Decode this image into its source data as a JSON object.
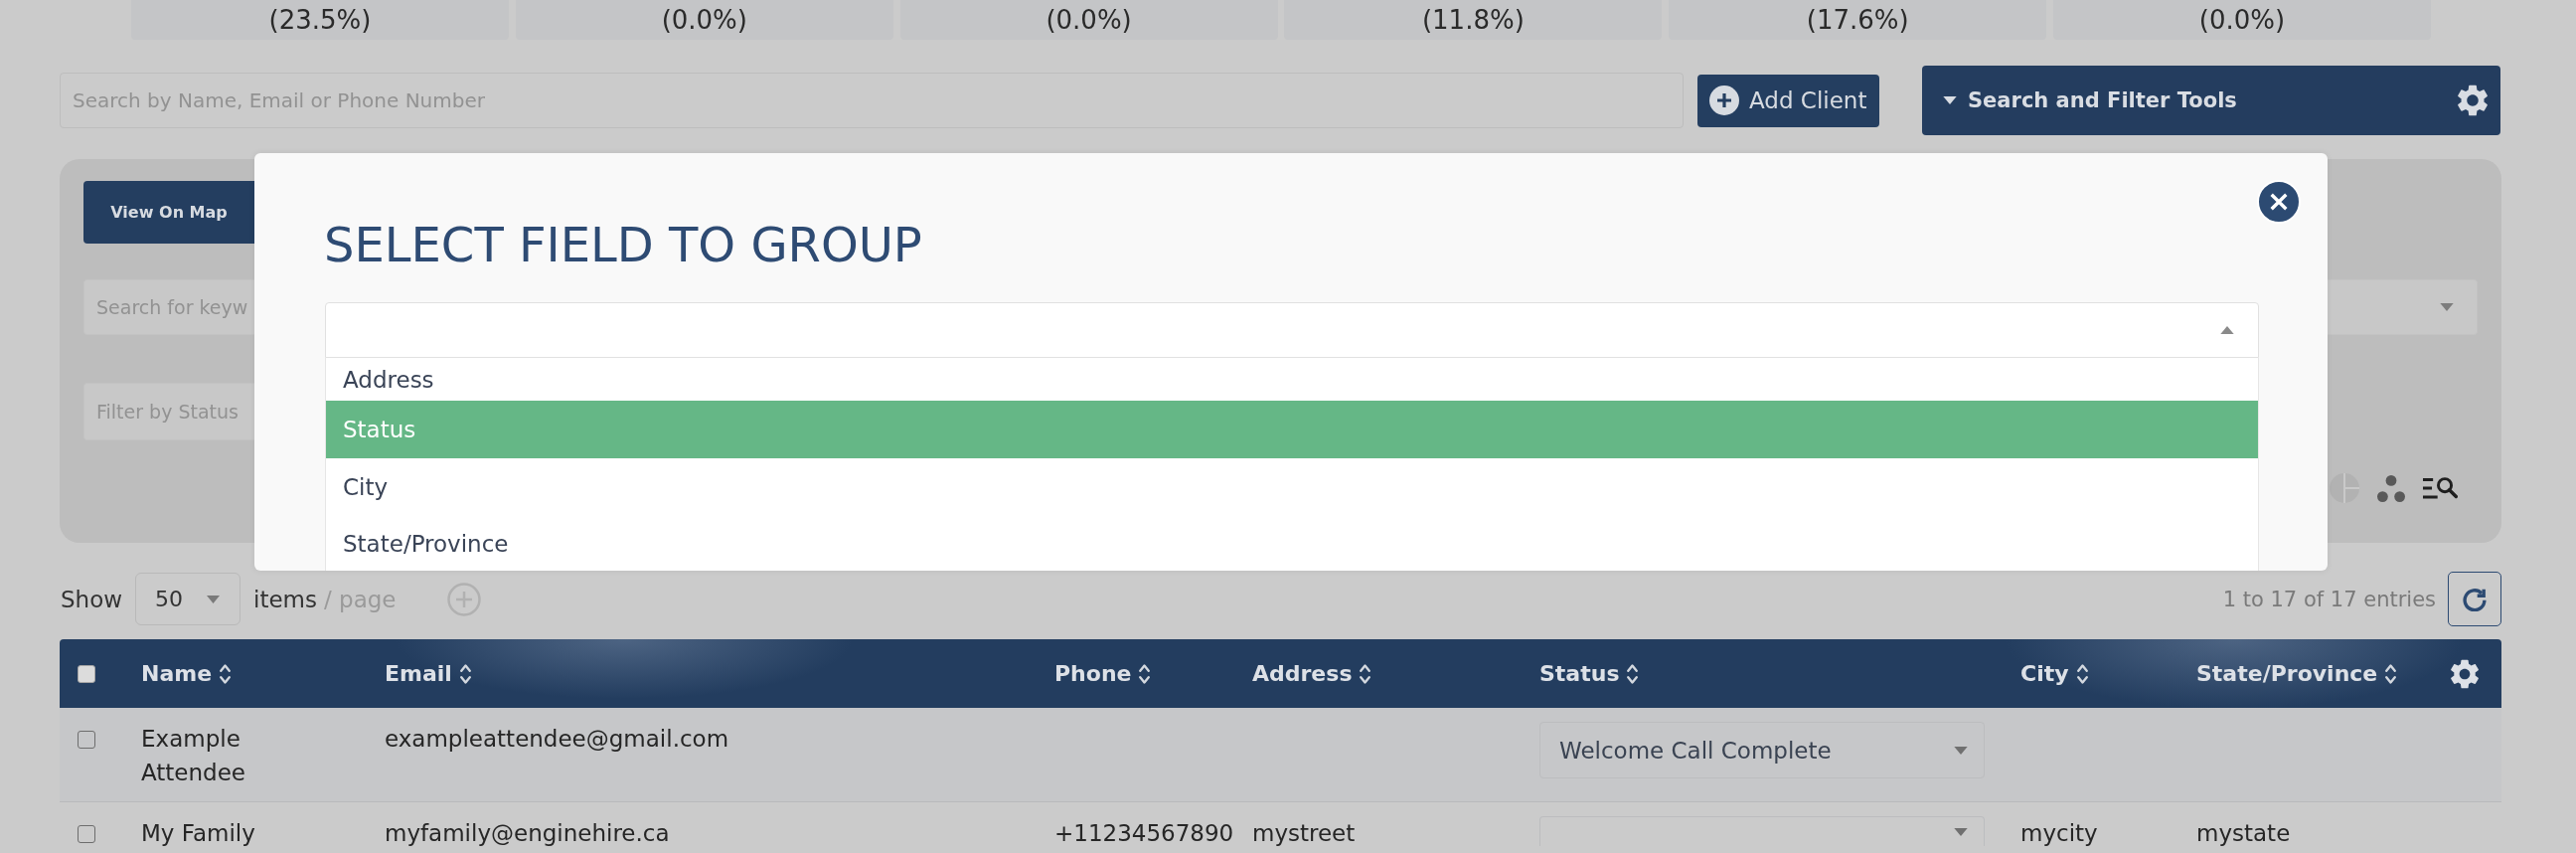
{
  "stat_cards": [
    {
      "value": "(23.5%)"
    },
    {
      "value": "(0.0%)"
    },
    {
      "value": "(0.0%)"
    },
    {
      "value": "(11.8%)"
    },
    {
      "value": "(17.6%)"
    },
    {
      "value": "(0.0%)"
    }
  ],
  "search": {
    "placeholder": "Search by Name, Email or Phone Number"
  },
  "add_client_button": {
    "label": "Add Client"
  },
  "filter_tools": {
    "title": "Search and Filter Tools",
    "expanded": true,
    "view_on_map_button": {
      "label": "View On Map"
    },
    "keyword_search": {
      "placeholder": "Search for keyw"
    },
    "status_filter": {
      "placeholder": "Filter by Status"
    }
  },
  "group_dialog": {
    "title": "SELECT FIELD TO GROUP",
    "select": {
      "open": true,
      "options": [
        {
          "label": "Address",
          "selected": false
        },
        {
          "label": "Status",
          "selected": true
        },
        {
          "label": "City",
          "selected": false
        },
        {
          "label": "State/Province",
          "selected": false
        }
      ]
    }
  },
  "pagination": {
    "show_label": "Show",
    "page_size": "50",
    "items_label": "items",
    "per_page_label": "/ page",
    "entries": "1 to 17 of 17 entries"
  },
  "table": {
    "select_all": {
      "checked": false
    },
    "columns": [
      {
        "label": "Name"
      },
      {
        "label": "Email"
      },
      {
        "label": "Phone"
      },
      {
        "label": "Address"
      },
      {
        "label": "Status"
      },
      {
        "label": "City"
      },
      {
        "label": "State/Province"
      }
    ],
    "rows": [
      {
        "checked": false,
        "name": "Example Attendee",
        "email": "exampleattendee@gmail.com",
        "status": "Welcome Call Complete"
      },
      {
        "checked": false,
        "name": "My Family",
        "email": "myfamily@enginehire.ca",
        "phone": "+11234567890",
        "address": "mystreet",
        "city": "mycity",
        "state": "mystate"
      }
    ]
  }
}
